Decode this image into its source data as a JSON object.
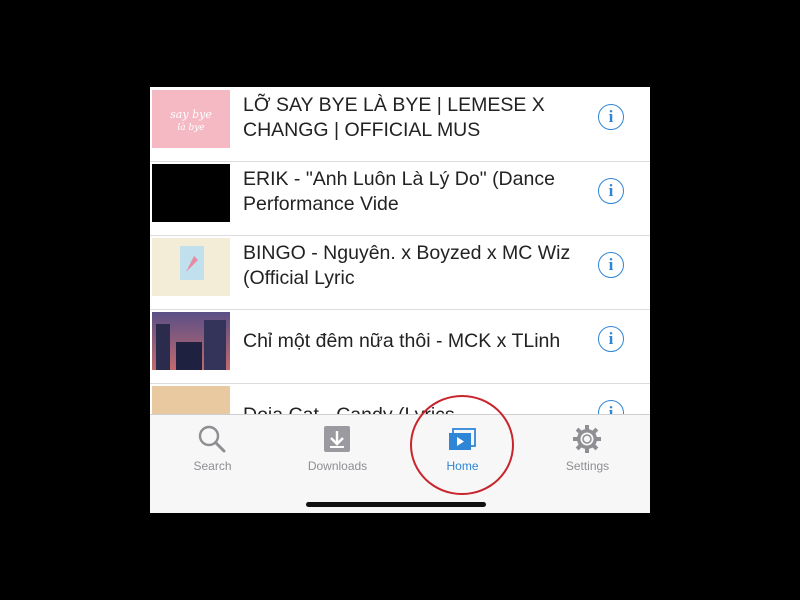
{
  "videos": [
    {
      "title": "LỠ SAY BYE LÀ BYE | LEMESE X CHANGG | OFFICIAL MUS",
      "thumb_color": "#f4b9c2"
    },
    {
      "title": "ERIK - \"Anh Luôn Là Lý Do\" (Dance Performance Vide",
      "thumb_color": "#000000"
    },
    {
      "title": "BINGO - Nguyên. x Boyzed x MC Wiz (Official Lyric",
      "thumb_color": "#f3ecd6"
    },
    {
      "title": "Chỉ một đêm nữa thôi - MCK x TLinh",
      "thumb_color": "#3a3f6e"
    },
    {
      "title": "Doja Cat - Candy (Lyrics",
      "thumb_color": "#e8c9a0"
    }
  ],
  "info_glyph": "i",
  "tabs": [
    {
      "label": "Search",
      "icon": "search-icon",
      "active": false
    },
    {
      "label": "Downloads",
      "icon": "download-icon",
      "active": false
    },
    {
      "label": "Home",
      "icon": "home-icon",
      "active": true
    },
    {
      "label": "Settings",
      "icon": "gear-icon",
      "active": false
    }
  ],
  "colors": {
    "accent": "#2f86d6",
    "inactive": "#8e8e93",
    "annotation_circle": "#c8242b"
  }
}
